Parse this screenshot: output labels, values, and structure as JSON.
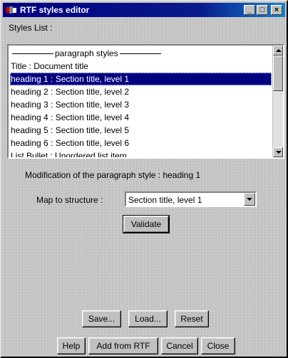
{
  "window": {
    "title": "RTF styles editor",
    "controls": {
      "minimize": "_",
      "maximize": "□",
      "close": "×"
    }
  },
  "styles_list": {
    "label": "Styles List :",
    "header_text": "paragraph styles",
    "items": [
      "Title : Document title",
      "heading 1 : Section title, level 1",
      "heading 2 : Section title, level 2",
      "heading 3 : Section title, level 3",
      "heading 4 : Section title, level 4",
      "heading 5 : Section title, level 5",
      "heading 6 : Section title, level 6",
      "List Bullet : Unordered list item"
    ],
    "selected_index": 1
  },
  "modification": {
    "label": "Modification of the paragraph style : heading 1",
    "map_label": "Map to structure :",
    "map_value": "Section title, level 1",
    "validate": "Validate"
  },
  "buttons": {
    "save": "Save...",
    "load": "Load...",
    "reset": "Reset",
    "help": "Help",
    "add_from_rtf": "Add from RTF",
    "cancel": "Cancel",
    "close": "Close"
  },
  "colors": {
    "title_bar": "#000080",
    "selection": "#000080",
    "face": "#c0c0c0"
  }
}
